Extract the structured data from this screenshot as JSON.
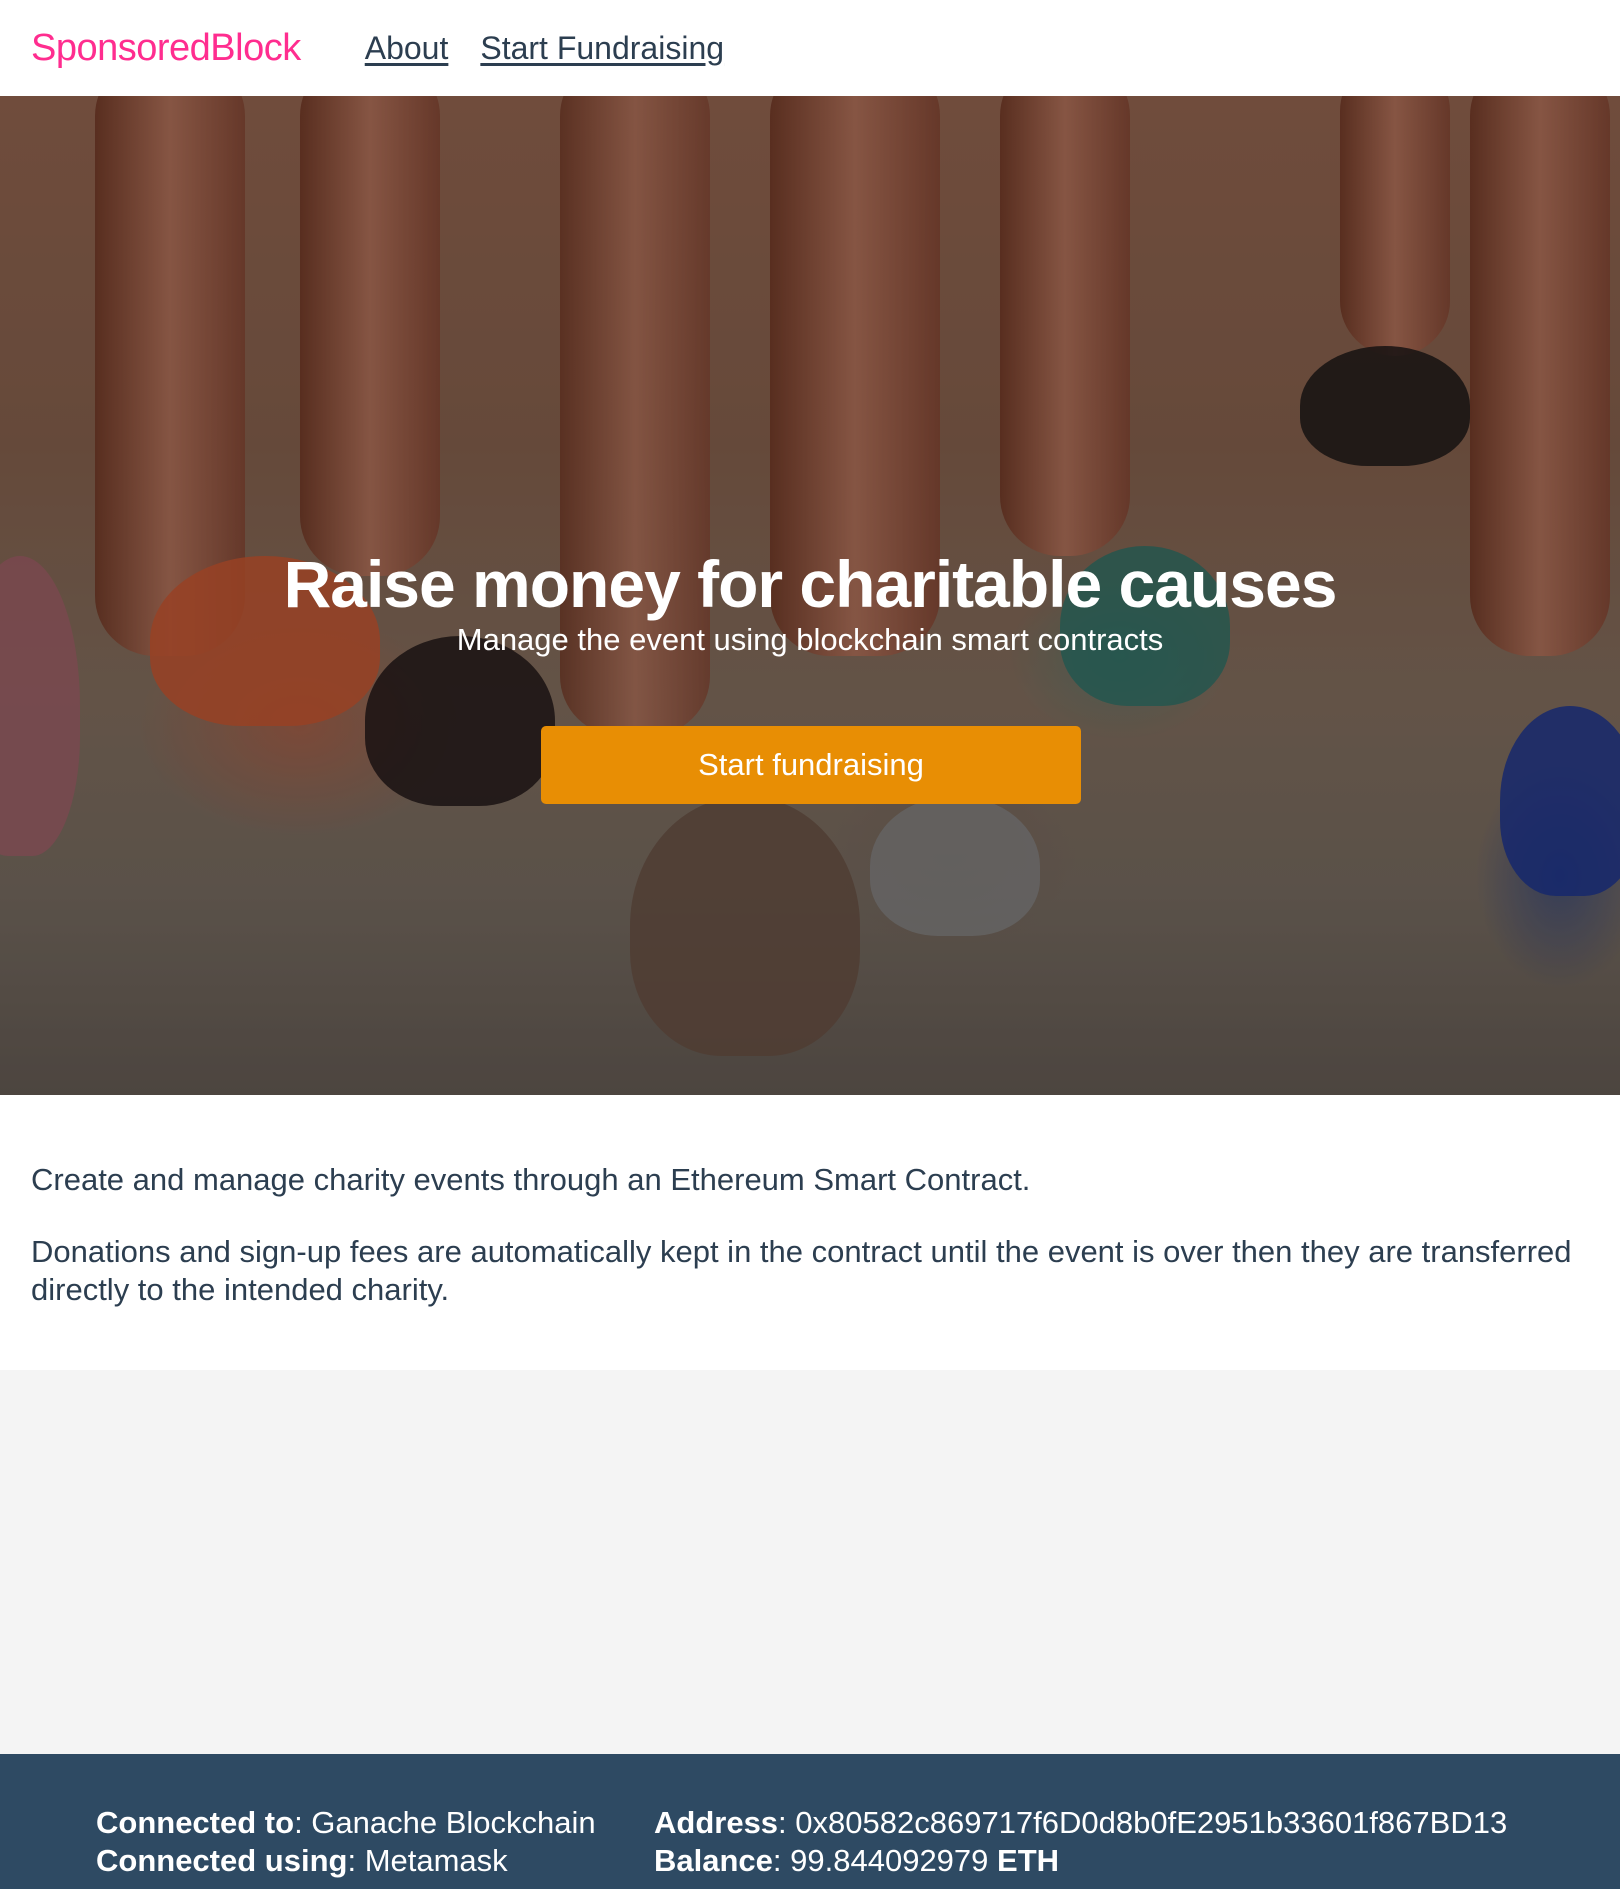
{
  "colors": {
    "brand": "#ff2d8f",
    "accent": "#e88e04",
    "footer_bg": "#2e4a63",
    "text": "#2c3e50"
  },
  "header": {
    "brand": "SponsoredBlock",
    "nav": [
      {
        "label": "About"
      },
      {
        "label": "Start Fundraising"
      }
    ]
  },
  "hero": {
    "title": "Raise money for charitable causes",
    "subtitle": "Manage the event using blockchain smart contracts",
    "cta_label": "Start fundraising"
  },
  "intro": {
    "paragraphs": [
      "Create and manage charity events through an Ethereum Smart Contract.",
      "Donations and sign-up fees are automatically kept in the contract until the event is over then they are transferred directly to the intended charity."
    ]
  },
  "footer": {
    "connected_to_label": "Connected to",
    "connected_to_value": "Ganache Blockchain",
    "connected_using_label": "Connected using",
    "connected_using_value": "Metamask",
    "address_label": "Address",
    "address_value": "0x80582c869717f6D0d8b0fE2951b33601f867BD13",
    "balance_label": "Balance",
    "balance_value": "99.844092979",
    "balance_unit": "ETH"
  }
}
